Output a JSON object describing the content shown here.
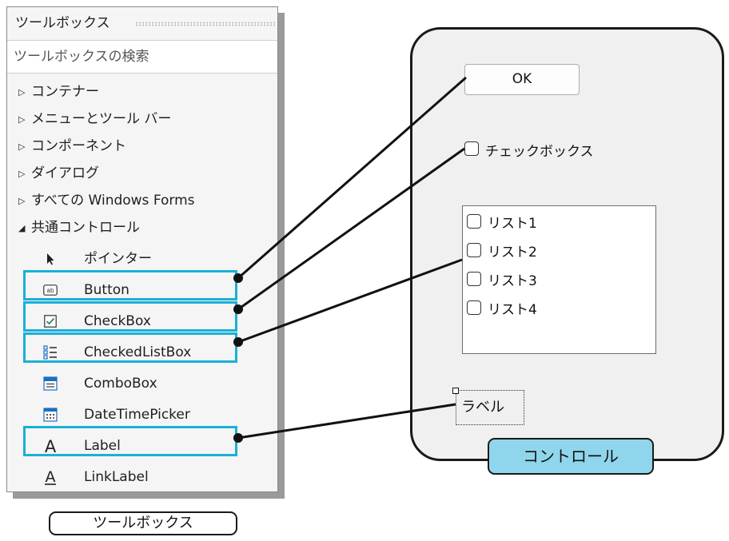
{
  "toolbox": {
    "title": "ツールボックス",
    "search_placeholder": "ツールボックスの検索",
    "categories": [
      {
        "label": "コンテナー",
        "arrow": "▷"
      },
      {
        "label": "メニューとツール バー",
        "arrow": "▷"
      },
      {
        "label": "コンポーネント",
        "arrow": "▷"
      },
      {
        "label": "ダイアログ",
        "arrow": "▷"
      },
      {
        "label": "すべての Windows Forms",
        "arrow": "▷"
      },
      {
        "label": "共通コントロール",
        "arrow": "◢"
      }
    ],
    "items": [
      {
        "label": "ポインター",
        "icon": "pointer-icon"
      },
      {
        "label": "Button",
        "icon": "button-icon"
      },
      {
        "label": "CheckBox",
        "icon": "checkbox-icon"
      },
      {
        "label": "CheckedListBox",
        "icon": "checked-list-box-icon"
      },
      {
        "label": "ComboBox",
        "icon": "combobox-icon"
      },
      {
        "label": "DateTimePicker",
        "icon": "date-time-picker-icon"
      },
      {
        "label": "Label",
        "icon": "label-icon"
      },
      {
        "label": "LinkLabel",
        "icon": "link-label-icon"
      }
    ],
    "caption": "ツールボックス"
  },
  "form": {
    "button_text": "OK",
    "checkbox_text": "チェックボックス",
    "list_items": [
      "リスト1",
      "リスト2",
      "リスト3",
      "リスト4"
    ],
    "label_text": "ラベル",
    "caption": "コントロール"
  },
  "colors": {
    "highlight": "#1ab0d6",
    "caption_fill": "#8fd6ec"
  }
}
